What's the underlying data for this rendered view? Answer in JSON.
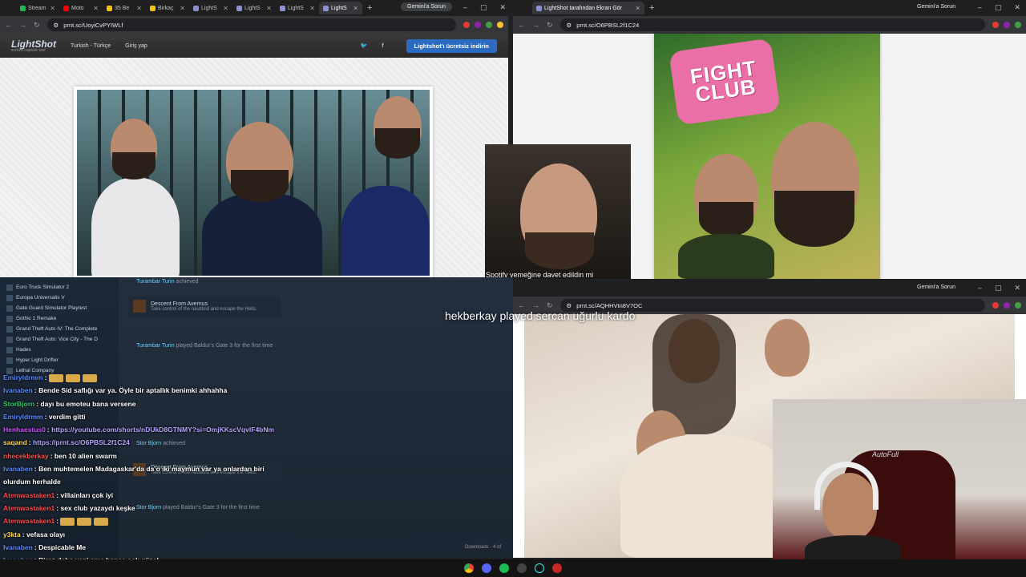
{
  "top_left_browser": {
    "tabs": [
      {
        "label": "Stream",
        "color": "#1db954"
      },
      {
        "label": "Moto",
        "color": "#ff0000"
      },
      {
        "label": "35 Be",
        "color": "#f4c20d"
      },
      {
        "label": "Birkaç",
        "color": "#f4c20d"
      },
      {
        "label": "LightS",
        "color": "#8a8fd8"
      },
      {
        "label": "LightS",
        "color": "#8a8fd8"
      },
      {
        "label": "LightS",
        "color": "#8a8fd8"
      },
      {
        "label": "LightS",
        "color": "#8a8fd8"
      }
    ],
    "gemini_label": "Gemini'a Sorun",
    "url": "prnt.sc/UoyiCvPYIWLf",
    "lightshot": {
      "logo": "LightShot",
      "tagline": "screen capture tool",
      "language": "Turkish - Türkçe",
      "login": "Giriş yap",
      "cta": "Lightshot'ı ücretsiz indirin"
    }
  },
  "top_right_browser": {
    "tab_label": "LightShot tarafından Ekran Gör",
    "gemini_label": "Gemini'a Sorun",
    "url": "prnt.sc/O6PBSL2f1C24",
    "soap_text": "FIGHT CLUB"
  },
  "center_cam": {
    "caption": "Spotify yemeğine davet edildin mi"
  },
  "bottom_right_browser": {
    "gemini_label": "Gemini'a Sorun",
    "url": "prnt.sc/AQHHVtn8V7OC",
    "overlay_text": "hekberkay played sercan uğurlu kardo"
  },
  "steam": {
    "games": [
      "Euro Truck Simulator 2",
      "Europa Universalis V",
      "Gate Guard Simulator Playtest",
      "Gothic 1 Remake",
      "Grand Theft Auto IV: The Complete",
      "Grand Theft Auto: Vice City - The D",
      "Hades",
      "Hyper Light Drifter",
      "Lethal Company"
    ],
    "activity": [
      {
        "user": "Turambar Turin",
        "text": "achieved"
      },
      {
        "user": "Turambar Turin",
        "text": "played Baldur's Gate 3 for the first time"
      },
      {
        "user": "Stor Bjorn",
        "text": "achieved"
      },
      {
        "user": "Stor Bjorn",
        "text": "played Baldur's Gate 3 for the first time"
      }
    ],
    "achievement_title": "Descent From Avernus",
    "achievement_desc": "Take control of the nautiloid and escape the Hells.",
    "downloads": "Downloads - 4 of"
  },
  "chat": [
    {
      "user": "Emiryldrmm",
      "color": "#5b8cff",
      "text": "",
      "emotes": true
    },
    {
      "user": "Ivanaben",
      "color": "#5b8cff",
      "text": "Bende Sid saflığı var ya. Öyle bir aptallık benimki ahhahha"
    },
    {
      "user": "StorBjorn",
      "color": "#2ecc71",
      "text": "dayı bu emoteu bana versene"
    },
    {
      "user": "Emiryldrmm",
      "color": "#5b8cff",
      "text": "verdim gitti"
    },
    {
      "user": "Henhaestus0",
      "color": "#d04dff",
      "text": "",
      "link": "https://youtube.com/shorts/nDUkD8GTNMY?si=OmjKKscVqvlF4bNm"
    },
    {
      "user": "saqand",
      "color": "#ffd54a",
      "text": "",
      "link": "https://prnt.sc/O6PBSL2f1C24"
    },
    {
      "user": "nhecekberkay",
      "color": "#ff4d4d",
      "text": "ben 10 alien swarm"
    },
    {
      "user": "Ivanaben",
      "color": "#5b8cff",
      "text": "Ben muhtemelen Madagaskar'da da o iki maymun var ya onlardan biri olurdum herhalde"
    },
    {
      "user": "Atemwastaken1",
      "color": "#ff4d4d",
      "text": "villainları çok iyi"
    },
    {
      "user": "Atemwastaken1",
      "color": "#ff4d4d",
      "text": "sex club yazaydı keşke"
    },
    {
      "user": "Atemwastaken1",
      "color": "#ff4d4d",
      "text": "",
      "emotes": true
    },
    {
      "user": "y3kta",
      "color": "#ffd54a",
      "text": "vefasa olayı"
    },
    {
      "user": "Ivanaben",
      "color": "#5b8cff",
      "text": "Despicable Me"
    },
    {
      "user": "Ivanaben",
      "color": "#5b8cff",
      "text": "Biraz daha yeni ama bence çok güzel."
    }
  ],
  "webcam": {
    "chair_label": "AutoFull"
  }
}
